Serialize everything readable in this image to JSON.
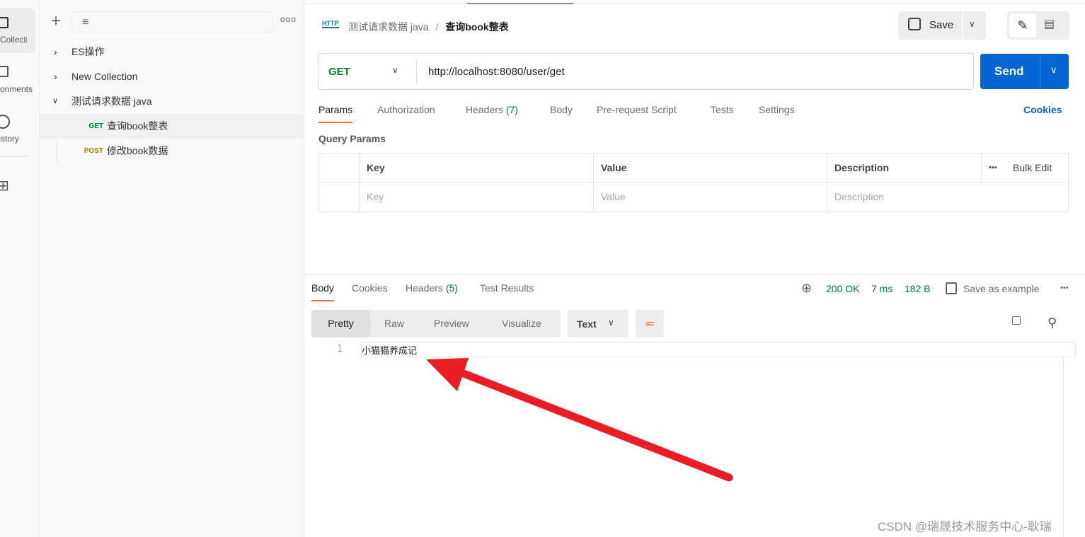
{
  "rail": {
    "items": [
      {
        "label": "Collections",
        "icon": "collections-icon"
      },
      {
        "label": "Environments",
        "icon": "environments-icon"
      },
      {
        "label": "History",
        "icon": "history-icon"
      },
      {
        "icon": "add-workspace-icon"
      }
    ]
  },
  "sidebar": {
    "tree": [
      {
        "label": "ES操作",
        "expanded": false
      },
      {
        "label": "New Collection",
        "expanded": false
      },
      {
        "label": "测试请求数据 java",
        "expanded": true,
        "children": [
          {
            "method": "GET",
            "label": "查询book整表",
            "selected": true
          },
          {
            "method": "POST",
            "label": "修改book数据"
          }
        ]
      }
    ]
  },
  "header": {
    "collection": "测试请求数据 java",
    "separator": "/",
    "request": "查询book整表",
    "save": "Save"
  },
  "request": {
    "method": "GET",
    "url": "http://localhost:8080/user/get",
    "send": "Send"
  },
  "req_tabs": [
    {
      "label": "Params",
      "active": true
    },
    {
      "label": "Authorization"
    },
    {
      "label": "Headers",
      "count": "(7)"
    },
    {
      "label": "Body"
    },
    {
      "label": "Pre-request Script"
    },
    {
      "label": "Tests"
    },
    {
      "label": "Settings"
    }
  ],
  "cookies": "Cookies",
  "params": {
    "title": "Query Params",
    "headers": [
      "Key",
      "Value",
      "Description"
    ],
    "bulk_edit": "Bulk Edit",
    "placeholders": [
      "Key",
      "Value",
      "Description"
    ]
  },
  "resp_tabs": [
    {
      "label": "Body",
      "active": true
    },
    {
      "label": "Cookies"
    },
    {
      "label": "Headers",
      "count": "(5)"
    },
    {
      "label": "Test Results"
    }
  ],
  "status": {
    "code": "200 OK",
    "time": "7 ms",
    "size": "182 B",
    "save_example": "Save as example"
  },
  "view_modes": [
    "Pretty",
    "Raw",
    "Preview",
    "Visualize"
  ],
  "format": "Text",
  "body": {
    "lines": [
      {
        "n": "1",
        "text": "小猫猫养成记"
      }
    ]
  },
  "watermark": "CSDN @瑞晟技术服务中心-耿瑞",
  "colors": {
    "accent": "#0265d2",
    "get": "#007f31",
    "post": "#ad7a03",
    "status": "#007f31",
    "arrow": "#ea1c24",
    "active_tab": "#ff6c37"
  }
}
